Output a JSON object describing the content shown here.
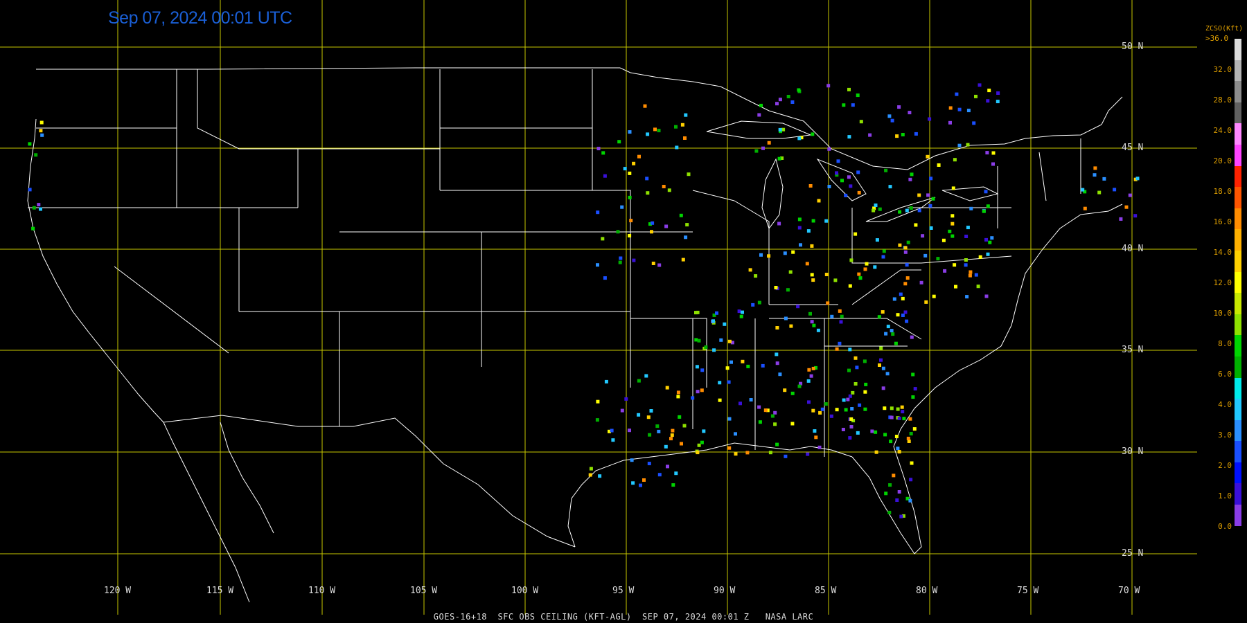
{
  "timestamp": "Sep 07, 2024 00:01 UTC",
  "footer": "GOES-16+18  SFC OBS CEILING (KFT-AGL)  SEP 07, 2024 00:01 Z   NASA LARC",
  "lat_labels": [
    "50 N",
    "45 N",
    "40 N",
    "35 N",
    "30 N",
    "25 N"
  ],
  "lon_labels": [
    "120 W",
    "115 W",
    "110 W",
    "105 W",
    "100 W",
    "95 W",
    "90 W",
    "85 W",
    "80 W",
    "75 W",
    "70 W"
  ],
  "legend": {
    "title": "ZCSO(Kft)",
    "top_label": ">36.0",
    "ticks": [
      "32.0",
      "28.0",
      "24.0",
      "20.0",
      "18.0",
      "16.0",
      "14.0",
      "12.0",
      "10.0",
      "8.0",
      "6.0",
      "4.0",
      "3.0",
      "2.0",
      "1.0",
      "0.0"
    ],
    "colors": [
      "#8a3de6",
      "#3a10d8",
      "#0010ff",
      "#1a4fff",
      "#2a8fff",
      "#22c8ff",
      "#00eaea",
      "#00b000",
      "#00d400",
      "#8ee000",
      "#c8e800",
      "#ffff00",
      "#ffd000",
      "#ffb000",
      "#ff8c00",
      "#ff5500",
      "#ff2200",
      "#ff44ff",
      "#ff88ff",
      "#606060",
      "#8c8c8c",
      "#b4b4b4",
      "#dcdcdc"
    ]
  },
  "colors": {
    "grid": "#c8c800",
    "boundaries": "#ffffff",
    "timestamp": "#1a5fd6"
  }
}
